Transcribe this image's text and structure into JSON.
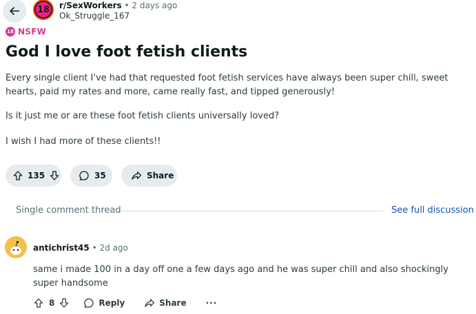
{
  "post": {
    "subreddit": "r/SexWorkers",
    "subreddit_avatar_text": "18",
    "separator": "•",
    "time": "2 days ago",
    "author": "Ok_Struggle_167",
    "nsfw_badge": "18",
    "nsfw_label": "NSFW",
    "title": "God I love foot fetish clients",
    "paragraphs": [
      "Every single client I've had that requested foot fetish services have always been super chill, sweet hearts, paid my rates and more, came really fast, and tipped generously!",
      "Is it just me or are these foot fetish clients universally loved?",
      "I wish I had more of these clients!!"
    ],
    "votes": "135",
    "comments": "35",
    "share_label": "Share"
  },
  "thread": {
    "label": "Single comment thread",
    "see_full": "See full discussion"
  },
  "comment": {
    "author": "antichrist45",
    "separator": "•",
    "time": "2d ago",
    "body": "same i made 100 in a day off one a few days ago and he was super chill and also shockingly super handsome",
    "votes": "8",
    "reply_label": "Reply",
    "share_label": "Share",
    "more_label": "···"
  },
  "icons": {
    "back": "arrow-left-icon",
    "upvote": "arrow-up-icon",
    "downvote": "arrow-down-icon",
    "comment": "speech-bubble-icon",
    "share": "share-arrow-icon",
    "more": "ellipsis-icon"
  },
  "colors": {
    "nsfw": "#d93a8e",
    "subreddit_avatar": "#ff1a8c",
    "link": "#0b52b8",
    "pill_bg": "#e5ebee"
  }
}
